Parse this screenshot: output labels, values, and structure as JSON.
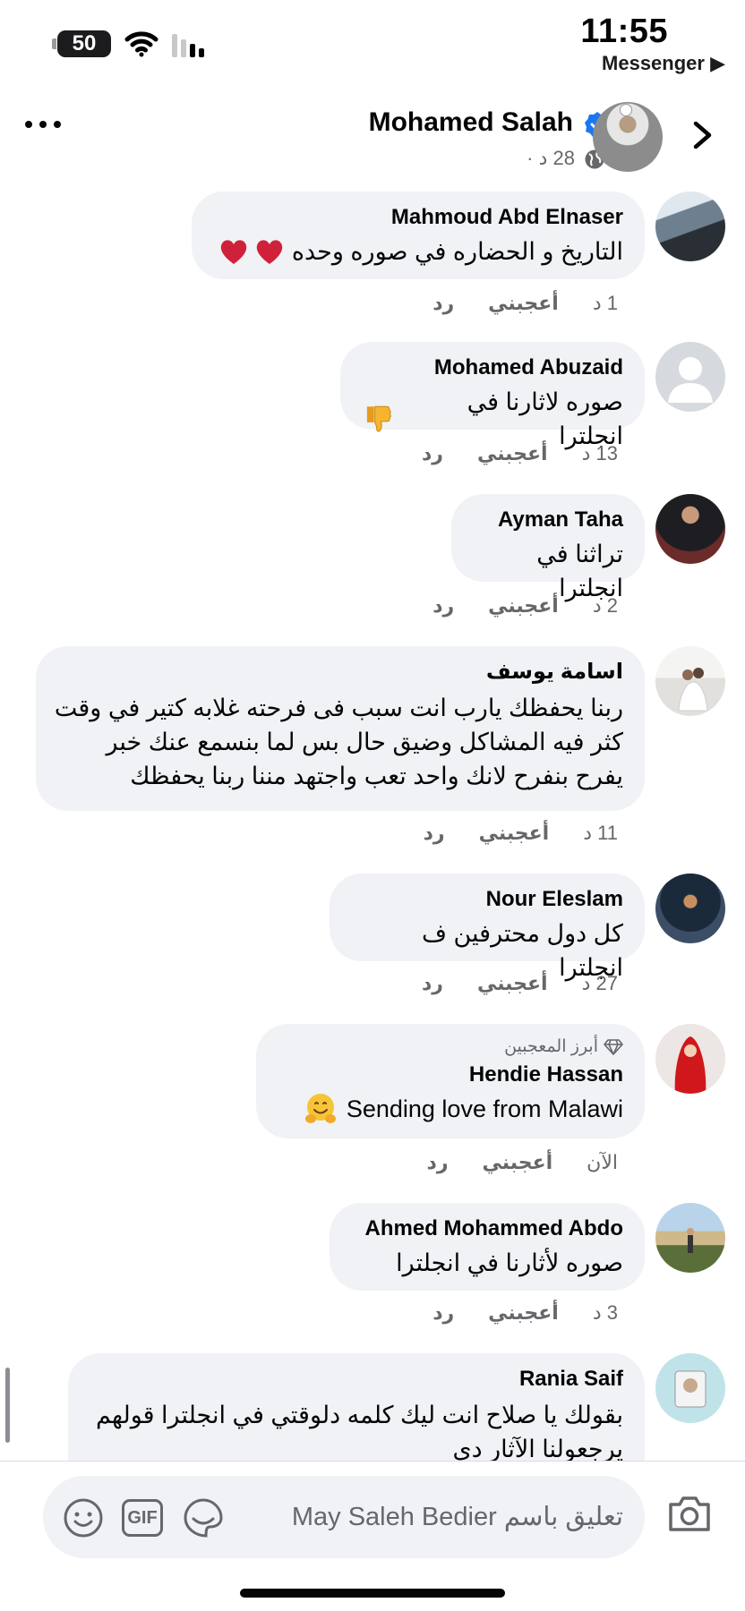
{
  "status": {
    "battery": "50",
    "time": "11:55",
    "back_app": "Messenger ▶"
  },
  "post_header": {
    "name": "Mohamed Salah",
    "meta": "28 د ·"
  },
  "comments": [
    {
      "author": "Mahmoud Abd Elnaser",
      "text": "التاريخ و الحضاره في صوره وحده",
      "time": "1 د",
      "like": "أعجبني",
      "reply": "رد"
    },
    {
      "author": "Mohamed Abuzaid",
      "text": "صوره لاثارنا في انجلترا",
      "time": "13 د",
      "like": "أعجبني",
      "reply": "رد"
    },
    {
      "author": "Ayman Taha",
      "text": "تراثنا في انجلترا",
      "time": "2 د",
      "like": "أعجبني",
      "reply": "رد"
    },
    {
      "author": "اسامة يوسف",
      "lines": [
        "ربنا يحفظك يارب انت سبب فى فرحته غلابه كتير في وقت",
        "كثر فيه المشاكل وضيق حال بس لما بنسمع عنك خبر",
        "يفرح بنفرح لانك واحد تعب واجتهد مننا ربنا يحفظك"
      ],
      "time": "11 د",
      "like": "أعجبني",
      "reply": "رد"
    },
    {
      "author": "Nour Eleslam",
      "text": "كل دول محترفين ف انجلترا",
      "time": "27 د",
      "like": "أعجبني",
      "reply": "رد"
    },
    {
      "badge": "أبرز المعجبين",
      "author": "Hendie Hassan",
      "text": "Sending love from Malawi",
      "time": "الآن",
      "like": "أعجبني",
      "reply": "رد"
    },
    {
      "author": "Ahmed Mohammed Abdo",
      "text": "صوره لأثارنا في انجلترا",
      "time": "3 د",
      "like": "أعجبني",
      "reply": "رد"
    },
    {
      "author": "Rania Saif",
      "lines": [
        "بقولك يا صلاح انت ليك كلمه دلوقتي في انجلترا قولهم",
        "يرجعولنا الآثار دي"
      ]
    }
  ],
  "compose": {
    "placeholder": "تعليق باسم May Saleh Bedier",
    "gif_label": "GIF"
  },
  "icons": [
    "wifi-icon",
    "signal-icon",
    "verified-icon",
    "globe-icon",
    "more-icon",
    "chevron-right-icon",
    "heart-icon",
    "thumbs-down-icon",
    "hugging-face-icon",
    "diamond-icon",
    "smiley-icon",
    "gif-icon",
    "sticker-icon",
    "camera-icon"
  ],
  "colors": {
    "bubble": "#f0f2f5",
    "meta": "#65676b",
    "verified": "#1877f2"
  }
}
